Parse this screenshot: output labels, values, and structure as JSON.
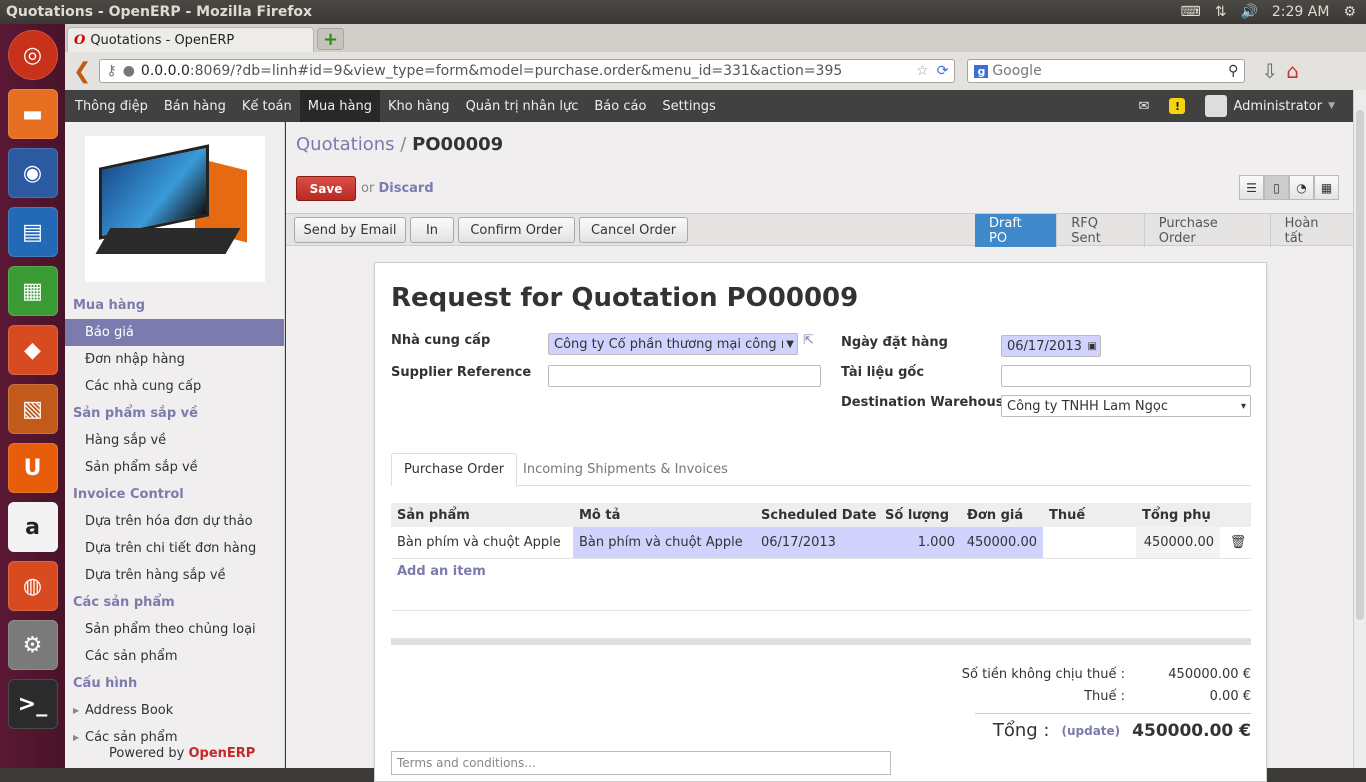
{
  "os": {
    "window_title": "Quotations - OpenERP - Mozilla Firefox",
    "clock": "2:29 AM"
  },
  "browser": {
    "tab_title": "Quotations - OpenERP",
    "url_host": "0.0.0.0",
    "url_rest": ":8069/?db=linh#id=9&view_type=form&model=purchase.order&menu_id=331&action=395",
    "search_placeholder": "Google"
  },
  "topmenu": [
    "Thông điệp",
    "Bán hàng",
    "Kế toán",
    "Mua hàng",
    "Kho hàng",
    "Quản trị nhân lực",
    "Báo cáo",
    "Settings"
  ],
  "user": "Administrator",
  "sidebar": {
    "sections": [
      {
        "title": "Mua hàng",
        "items": [
          "Báo giá",
          "Đơn nhập hàng",
          "Các nhà cung cấp"
        ]
      },
      {
        "title": "Sản phẩm sắp về",
        "items": [
          "Hàng sắp về",
          "Sản phẩm sắp về"
        ]
      },
      {
        "title": "Invoice Control",
        "items": [
          "Dựa trên hóa đơn dự thảo",
          "Dựa trên chi tiết đơn hàng",
          "Dựa trên hàng sắp về"
        ]
      },
      {
        "title": "Các sản phẩm",
        "items": [
          "Sản phẩm theo chủng loại",
          "Các sản phẩm"
        ]
      },
      {
        "title": "Cấu hình",
        "items": [
          "Address Book",
          "Các sản phẩm"
        ]
      }
    ],
    "powered_prefix": "Powered by ",
    "powered_brand": "OpenERP"
  },
  "breadcrumb": {
    "parent": "Quotations",
    "sep": " / ",
    "current": "PO00009"
  },
  "buttons": {
    "save": "Save",
    "or": "or",
    "discard": "Discard",
    "send_email": "Send by Email",
    "print": "In",
    "confirm": "Confirm Order",
    "cancel": "Cancel Order"
  },
  "statusbar": [
    "Draft PO",
    "RFQ Sent",
    "Purchase Order",
    "Hoàn tất"
  ],
  "form": {
    "title": "Request for Quotation PO00009",
    "supplier_label": "Nhà cung cấp",
    "supplier_value": "Công ty Cổ phần thương mại công nghệ",
    "supplier_ref_label": "Supplier Reference",
    "supplier_ref_value": "",
    "order_date_label": "Ngày đặt hàng",
    "order_date_value": "06/17/2013",
    "source_doc_label": "Tài liệu gốc",
    "source_doc_value": "",
    "warehouse_label": "Destination Warehouse",
    "warehouse_value": "Công ty TNHH Lam Ngọc"
  },
  "tabs": [
    "Purchase Order",
    "Incoming Shipments & Invoices"
  ],
  "lines": {
    "headers": [
      "Sản phẩm",
      "Mô tả",
      "Scheduled Date",
      "Số lượng",
      "Đơn giá",
      "Thuế",
      "Tổng phụ"
    ],
    "rows": [
      {
        "product": "Bàn phím và chuột Apple",
        "desc": "Bàn phím và chuột Apple",
        "date": "06/17/2013",
        "qty": "1.000",
        "price": "450000.00",
        "tax": "",
        "subtotal": "450000.00"
      }
    ],
    "add_item": "Add an item"
  },
  "totals": {
    "untaxed_label": "Số tiền không chịu thuế :",
    "untaxed": "450000.00 €",
    "tax_label": "Thuế :",
    "tax": "0.00 €",
    "total_label": "Tổng :",
    "update": "(update)",
    "total": "450000.00 €"
  },
  "terms_placeholder": "Terms and conditions..."
}
